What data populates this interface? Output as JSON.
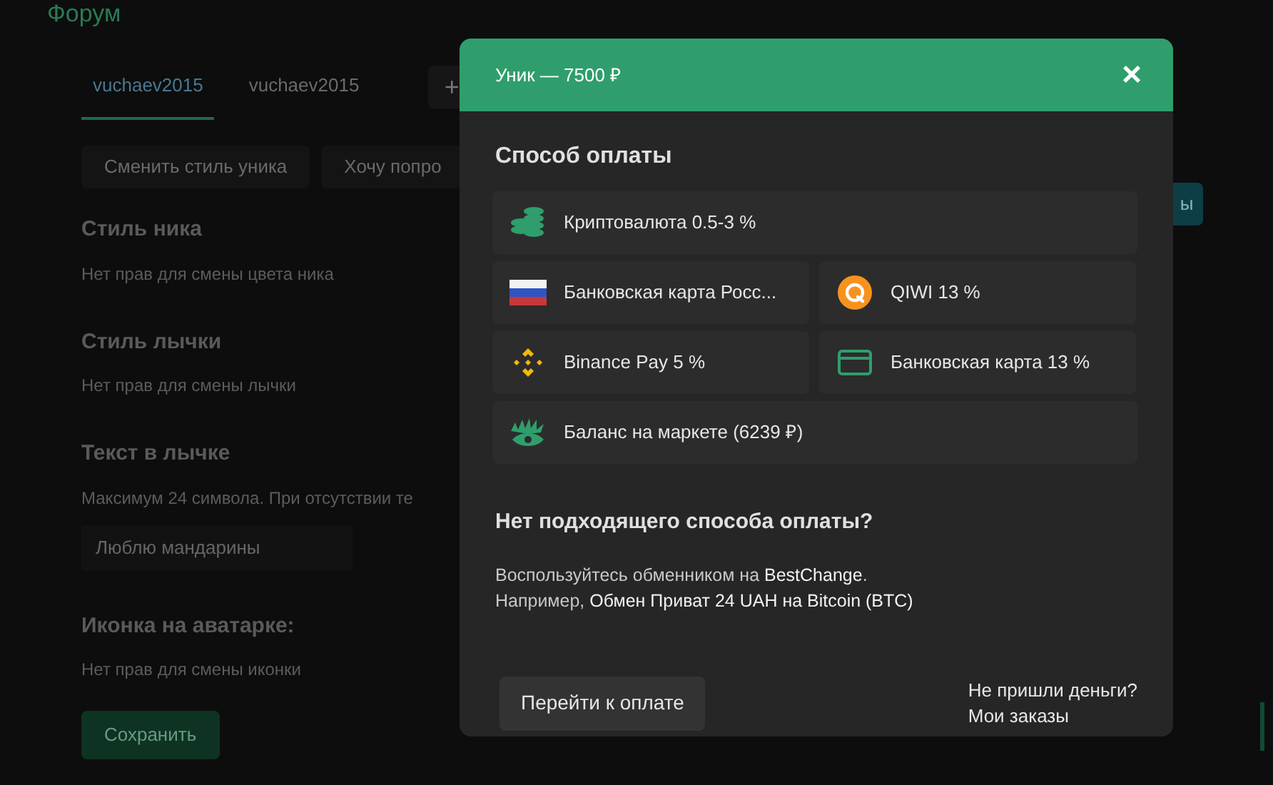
{
  "page": {
    "title": "Форум",
    "tabs": [
      {
        "label": "vuchaev2015",
        "selected": true
      },
      {
        "label": "vuchaev2015",
        "selected": false
      }
    ],
    "add_tab": "+",
    "actions": [
      "Сменить стиль уника",
      "Хочу попро"
    ],
    "side_button": "ы",
    "sections": [
      {
        "heading": "Стиль ника",
        "note": "Нет прав для смены цвета ника"
      },
      {
        "heading": "Стиль лычки",
        "note": "Нет прав для смены лычки"
      },
      {
        "heading": "Текст в лычке",
        "note": "Максимум 24 символа. При отсутствии те",
        "value": "Люблю мандарины"
      },
      {
        "heading": "Иконка на аватарке:",
        "note": "Нет прав для смены иконки"
      }
    ],
    "save": "Сохранить"
  },
  "dialog": {
    "title": "Уник — 7500 ₽",
    "close": "×",
    "section_title": "Способ оплаты",
    "methods": [
      {
        "kind": "coins",
        "label": "Криптовалюта 0.5-3 %",
        "wide": true
      },
      {
        "kind": "flag",
        "label": "Банковская карта Росс...",
        "wide": false
      },
      {
        "kind": "qiwi",
        "label": "QIWI 13 %",
        "wide": false
      },
      {
        "kind": "binance",
        "label": "Binance Pay 5 %",
        "wide": false
      },
      {
        "kind": "card",
        "label": "Банковская карта 13 %",
        "wide": false
      },
      {
        "kind": "market",
        "label": "Баланс на маркете (6239 ₽)",
        "wide": true
      }
    ],
    "help_title": "Нет подходящего способа оплаты?",
    "help_lines": [
      {
        "text": "Воспользуйтесь обменником на ",
        "link": "BestChange",
        "after": "."
      },
      {
        "text": "Например, ",
        "link": "Обмен Приват 24 UAH на Bitcoin (BTC)"
      }
    ],
    "pay_button": "Перейти к оплате",
    "links": [
      "Не пришли деньги?",
      "Мои заказы"
    ]
  }
}
